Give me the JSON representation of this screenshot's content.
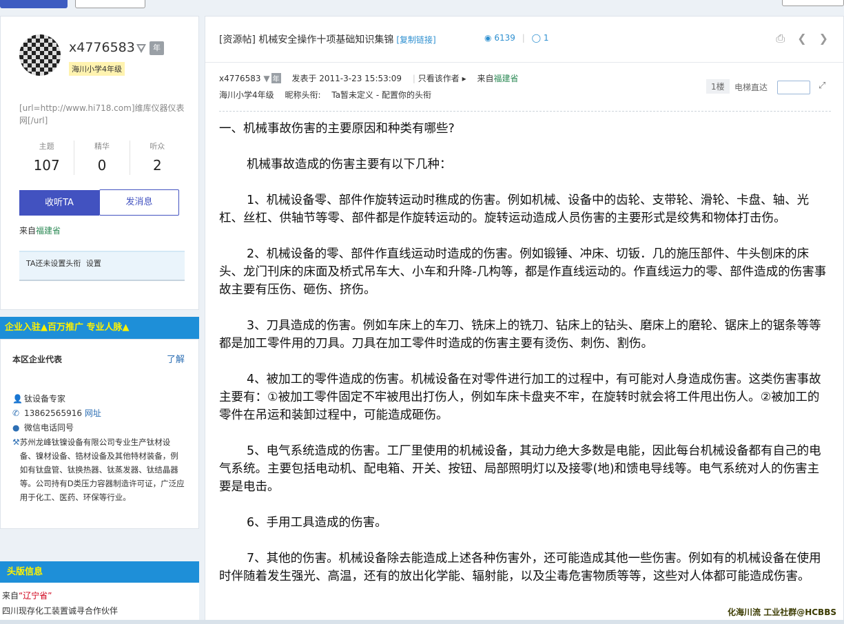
{
  "profile": {
    "username": "x4776583",
    "year_badge": "年",
    "grade": "海川小学4年级",
    "signature": "[url=http://www.hi718.com]维库仪器仪表网[/url]",
    "stats": [
      {
        "label": "主题",
        "value": "107"
      },
      {
        "label": "精华",
        "value": "0"
      },
      {
        "label": "听众",
        "value": "2"
      }
    ],
    "follow_label": "收听TA",
    "message_label": "发消息",
    "from_prefix": "来自",
    "from_location": "福建省",
    "headline_text": "TA还未设置头衔",
    "headline_set": "设置"
  },
  "enterprise": {
    "banner": "企业入驻▲百万推广 专业人脉▲",
    "title": "本区企业代表",
    "more": "了解",
    "contact_name": "钛设备专家",
    "phone": "13862565916",
    "website": "网址",
    "wechat": "微信电话同号",
    "description": "苏州龙峰钛镍设备有限公司专业生产钛材设备、镍材设备、锆材设备及其他特材装备，例如有钛盘管、钛换热器、钛蒸发器、钛结晶器等。公司持有D类压力容器制造许可证，广泛应用于化工、医药、环保等行业。"
  },
  "headlines": {
    "banner": "头版信息",
    "from_prefix": "来自",
    "from_location": "“辽宁省”",
    "text": "四川现存化工装置诚寻合作伙伴"
  },
  "post": {
    "title": "[资源帖] 机械安全操作十项基础知识集锦",
    "copy_link": "[复制链接]",
    "views": "6139",
    "replies": "1",
    "author": "x4776583",
    "author_year_badge": "年",
    "posted": "发表于 2011-3-23 15:53:09",
    "only_author": "只看该作者",
    "from_prefix": "来自",
    "from_location": "福建省",
    "author_grade": "海川小学4年级",
    "nickname_label": "昵称头衔:",
    "nickname_value": "Ta暂未定义 - 配置你的头衔",
    "floor": "1楼",
    "elevator_label": "电梯直达",
    "paragraphs": [
      "一、机械事故伤害的主要原因和种类有哪些?",
      "机械事故造成的伤害主要有以下几种：",
      "1、机械设备零、部件作旋转运动时穛成的伤害。例如机械、设备中的齿轮、支带轮、滑轮、卡盘、轴、光杠、丝杠、供轴节等零、部件都是作旋转运动的。旋转运动造成人员伤害的主要形式是绞隽和物体打击伤。",
      "2、机械设备的零、部件作直线运动时造成的伤害。例如锻锤、冲床、切钣．几的施压部件、牛头刨床的床头、龙门刊床的床面及桥式吊车大、小车和升降-几构等，都是作直线运动的。作直线运力的零、部件造成的伤害事故主要有压伤、砸伤、挤伤。",
      "3、刀具造成的伤害。例如车床上的车刀、铣床上的铣刀、钻床上的钻头、磨床上的磨轮、锯床上的锯条等等都是加工零件用的刀具。刀具在加工零件时造成的伤害主要有烫伤、刺伤、割伤。",
      "4、被加工的零件造成的伤害。机械设备在对零件进行加工的过程中，有可能对人身造成伤害。这类伤害事故主要有：①被加工零件固定不牢被甩出打伤人，例如车床卡盘夹不牢，在旋转时就会将工件甩出伤人。②被加工的零件在吊运和装卸过程中，可能造成砸伤。",
      "5、电气系统造成的伤害。工厂里使用的机械设备，其动力绝大多数是电能，因此每台机械设备都有自己的电气系统。主要包括电动机、配电箱、开关、按钮、局部照明灯以及接零(地)和馈电导线等。电气系统对人的伤害主要是电击。",
      "6、手用工具造成的伤害。",
      "7、其他的伤害。机械设备除去能造成上述各种伤害外，还可能造成其他一些伤害。例如有的机械设备在使用时伴随着发生强光、高温，还有的放出化学能、辐射能，以及尘毒危害物质等等，这些对人体都可能造成伤害。"
    ]
  },
  "watermark": "化海川流 工业社群@HCBBS"
}
